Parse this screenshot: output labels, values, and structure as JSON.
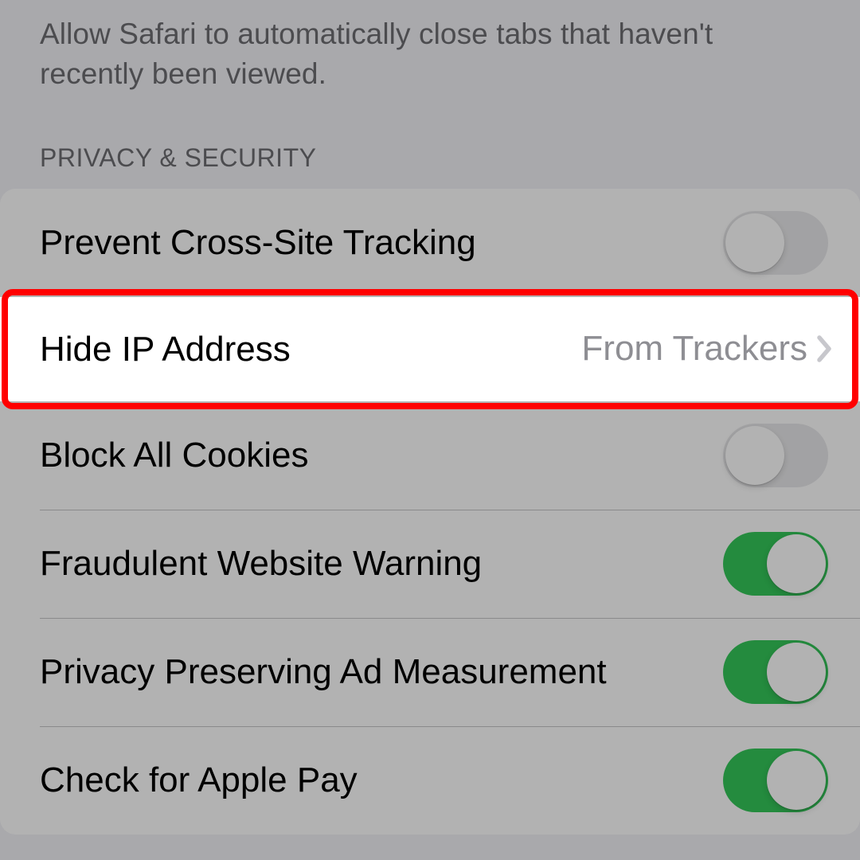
{
  "footer_text": "Allow Safari to automatically close tabs that haven't recently been viewed.",
  "section_header": "Privacy & Security",
  "rows": {
    "prevent_tracking": {
      "label": "Prevent Cross-Site Tracking",
      "on": false
    },
    "hide_ip": {
      "label": "Hide IP Address",
      "value": "From Trackers"
    },
    "block_cookies": {
      "label": "Block All Cookies",
      "on": false
    },
    "fraud_warning": {
      "label": "Fraudulent Website Warning",
      "on": true
    },
    "privacy_ad": {
      "label": "Privacy Preserving Ad Measurement",
      "on": true
    },
    "apple_pay": {
      "label": "Check for Apple Pay",
      "on": true
    }
  }
}
